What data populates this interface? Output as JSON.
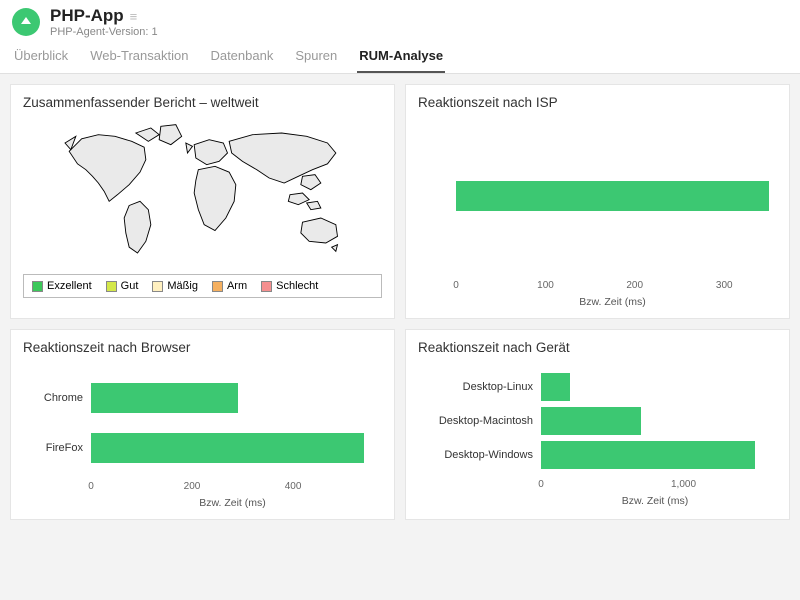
{
  "header": {
    "app_title": "PHP-App",
    "subtitle": "PHP-Agent-Version: 1"
  },
  "tabs": {
    "items": [
      "Überblick",
      "Web-Transaktion",
      "Datenbank",
      "Spuren",
      "RUM-Analyse"
    ],
    "active": 4
  },
  "panels": {
    "summary": {
      "title": "Zusammenfassender Bericht – weltweit",
      "legend": [
        {
          "label": "Exzellent",
          "color": "#3cc85a"
        },
        {
          "label": "Gut",
          "color": "#d4e84a"
        },
        {
          "label": "Mäßig",
          "color": "#fff0c0"
        },
        {
          "label": "Arm",
          "color": "#f5b060"
        },
        {
          "label": "Schlecht",
          "color": "#f59090"
        }
      ]
    },
    "isp": {
      "title": "Reaktionszeit nach ISP",
      "axis_label": "Bzw. Zeit (ms)"
    },
    "browser": {
      "title": "Reaktionszeit nach Browser",
      "axis_label": "Bzw. Zeit (ms)"
    },
    "device": {
      "title": "Reaktionszeit nach Gerät",
      "axis_label": "Bzw. Zeit (ms)"
    }
  },
  "chart_data": [
    {
      "id": "isp",
      "type": "bar",
      "orientation": "horizontal",
      "categories": [
        ""
      ],
      "values": [
        350
      ],
      "xlabel": "Bzw. Zeit (ms)",
      "xlim": [
        0,
        350
      ],
      "ticks": [
        0,
        100,
        200,
        300
      ]
    },
    {
      "id": "browser",
      "type": "bar",
      "orientation": "horizontal",
      "categories": [
        "Chrome",
        "FireFox"
      ],
      "values": [
        290,
        540
      ],
      "xlabel": "Bzw. Zeit (ms)",
      "xlim": [
        0,
        560
      ],
      "ticks": [
        0,
        200,
        400
      ]
    },
    {
      "id": "device",
      "type": "bar",
      "orientation": "horizontal",
      "categories": [
        "Desktop-Linux",
        "Desktop-Macintosh",
        "Desktop-Windows"
      ],
      "values": [
        200,
        700,
        1500
      ],
      "xlabel": "Bzw. Zeit (ms)",
      "xlim": [
        0,
        1600
      ],
      "ticks": [
        0,
        1000
      ]
    }
  ]
}
